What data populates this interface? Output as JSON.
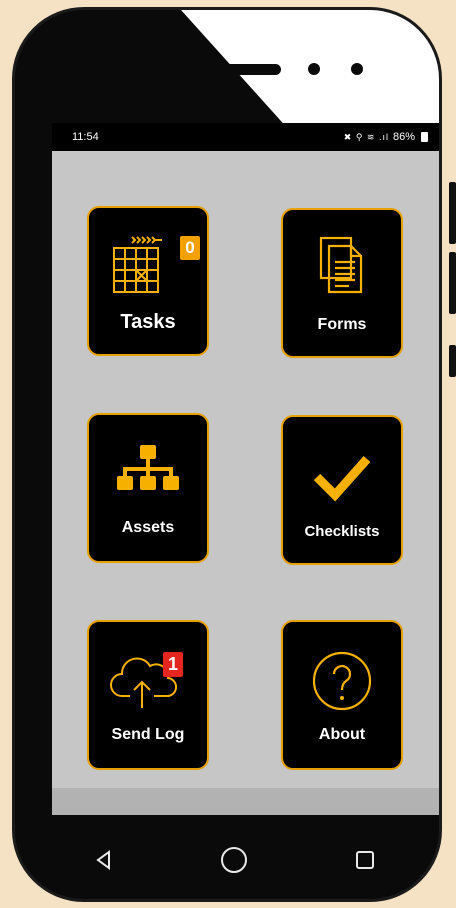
{
  "status_bar": {
    "time": "11:54",
    "icons": "✖ ⚲ ≋ .ıl",
    "battery": "86%"
  },
  "tiles": [
    {
      "label": "Tasks",
      "icon": "calendar-grid-icon",
      "badge": "0",
      "badge_color": "#f2a100"
    },
    {
      "label": "Forms",
      "icon": "documents-icon"
    },
    {
      "label": "Assets",
      "icon": "hierarchy-icon"
    },
    {
      "label": "Checklists",
      "icon": "checkmark-icon"
    },
    {
      "label": "Send Log",
      "icon": "cloud-upload-icon",
      "badge": "1",
      "badge_color": "#e5261f"
    },
    {
      "label": "About",
      "icon": "help-circle-icon"
    }
  ],
  "nav": {
    "back": "◁",
    "home": "○",
    "recent": "□"
  },
  "colors": {
    "accent": "#f5b000",
    "tile_border": "#e6a000",
    "screen_bg": "#c6c6c6",
    "page_bg": "#f5e1c4"
  }
}
